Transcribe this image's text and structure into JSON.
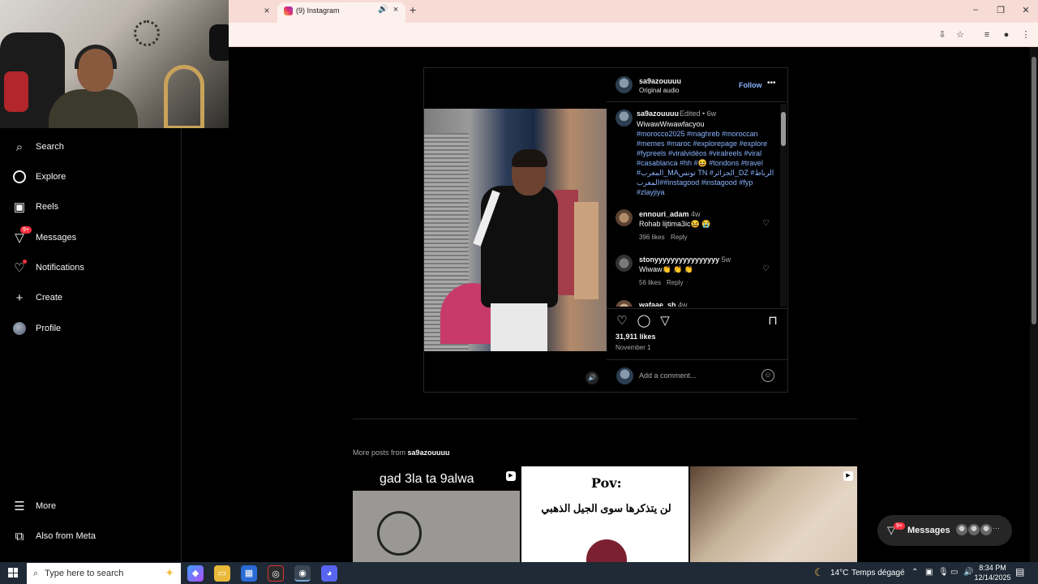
{
  "browser": {
    "tab_title": "(9) Instagram",
    "tab_close": "×",
    "prev_tab_close": "×",
    "new_tab": "+",
    "win_min": "–",
    "win_restore": "❐",
    "win_close": "✕"
  },
  "sidebar": {
    "items": [
      {
        "label": "Search",
        "icon": "search-icon"
      },
      {
        "label": "Explore",
        "icon": "compass-icon"
      },
      {
        "label": "Reels",
        "icon": "reels-icon"
      },
      {
        "label": "Messages",
        "icon": "messenger-icon",
        "badge": "9+"
      },
      {
        "label": "Notifications",
        "icon": "heart-icon"
      },
      {
        "label": "Create",
        "icon": "plus-icon"
      },
      {
        "label": "Profile",
        "icon": "avatar"
      },
      {
        "label": "More",
        "icon": "menu-icon"
      },
      {
        "label": "Also from Meta",
        "icon": "meta-icon"
      }
    ]
  },
  "post": {
    "username": "sa9azouuuu",
    "audio": "Original audio",
    "follow": "Follow",
    "more": "•••",
    "caption_user": "sa9azouuuu",
    "caption_meta": "Edited • 6w",
    "caption_text": "WiwawWiwawfacyou",
    "caption_tags": "#morocco2025 #maghreb #moroccan #memes #maroc #explorepage #explore #fypreels #viralvidéos #viralreels #viral #casablanca #hh #😆 #tondons #travel #المغرب_MAتونس TN #الجزائر_DZ #الرباط #المغرب#instagood #instagood #fyp #zlayjiya",
    "comments": [
      {
        "user": "ennouri_adam",
        "time": "4w",
        "text": "Rohab lijtima3ic😆 😭",
        "likes": "396 likes",
        "reply": "Reply"
      },
      {
        "user": "stonyyyyyyyyyyyyyyyy",
        "time": "5w",
        "text": "Wiwaw👏 👏 👏",
        "likes": "56 likes",
        "reply": "Reply"
      },
      {
        "user": "wafaae_sh",
        "time": "4w",
        "text": "",
        "likes": "",
        "reply": ""
      }
    ],
    "likes": "31,911 likes",
    "date": "November 1",
    "comment_placeholder": "Add a comment..."
  },
  "more_posts": {
    "label": "More posts from",
    "user": "sa9azouuuu",
    "thumb1_text": "gad 3la ta 9alwa",
    "thumb2_title": "Pov:",
    "thumb2_text": "لن يتذكرها سوى الجيل الذهبي"
  },
  "messages_float": {
    "label": "Messages",
    "badge": "9+",
    "dots": "···"
  },
  "taskbar": {
    "search_placeholder": "Type here to search",
    "temperature": "14°C",
    "weather": "Temps dégagé",
    "time": "8:34 PM",
    "date": "12/14/2025"
  }
}
